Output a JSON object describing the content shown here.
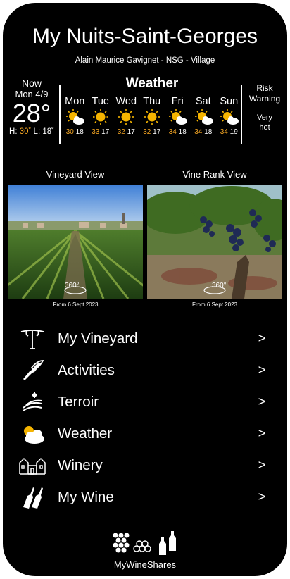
{
  "header": {
    "title": "My Nuits-Saint-Georges",
    "subtitle": "Alain  Maurice Gavignet -  NSG - Village"
  },
  "current": {
    "label": "Now",
    "date": "Mon 4/9",
    "temp": "28°",
    "high_label": "H:",
    "high": "30˚",
    "low_label": "L:",
    "low": "18˚"
  },
  "weather": {
    "heading": "Weather",
    "days": [
      {
        "day": "Mon",
        "high": "30",
        "low": "18",
        "icon": "partly-cloudy-icon"
      },
      {
        "day": "Tue",
        "high": "33",
        "low": "17",
        "icon": "sun-icon"
      },
      {
        "day": "Wed",
        "high": "32",
        "low": "17",
        "icon": "sun-icon"
      },
      {
        "day": "Thu",
        "high": "32",
        "low": "17",
        "icon": "sun-icon"
      },
      {
        "day": "Fri",
        "high": "34",
        "low": "18",
        "icon": "partly-cloudy-icon"
      },
      {
        "day": "Sat",
        "high": "34",
        "low": "18",
        "icon": "partly-cloudy-icon"
      },
      {
        "day": "Sun",
        "high": "34",
        "low": "19",
        "icon": "partly-cloudy-icon"
      }
    ]
  },
  "risk": {
    "title_line1": "Risk",
    "title_line2": "Warning",
    "value_line1": "Very",
    "value_line2": "hot"
  },
  "views": {
    "vineyard": {
      "label": "Vineyard View",
      "badge": "360°",
      "caption": "From 6 Sept 2023"
    },
    "vinerank": {
      "label": "Vine Rank View",
      "badge": "360°",
      "caption": "From 6 Sept 2023"
    }
  },
  "menu": [
    {
      "label": "My Vineyard",
      "arrow": ">",
      "icon": "vine-icon"
    },
    {
      "label": "Activities",
      "arrow": ">",
      "icon": "pruning-shears-icon"
    },
    {
      "label": "Terroir",
      "arrow": ">",
      "icon": "terroir-icon"
    },
    {
      "label": "Weather",
      "arrow": ">",
      "icon": "cloud-sun-icon"
    },
    {
      "label": "Winery",
      "arrow": ">",
      "icon": "chateau-icon"
    },
    {
      "label": "My Wine",
      "arrow": ">",
      "icon": "wine-bottles-icon"
    }
  ],
  "footer": {
    "brand": "MyWineShares",
    "icons": [
      "grapes-icon",
      "rings-icon",
      "bottle-glass-icon"
    ]
  },
  "colors": {
    "background": "#000000",
    "accent": "#f5a623",
    "text": "#ffffff"
  }
}
